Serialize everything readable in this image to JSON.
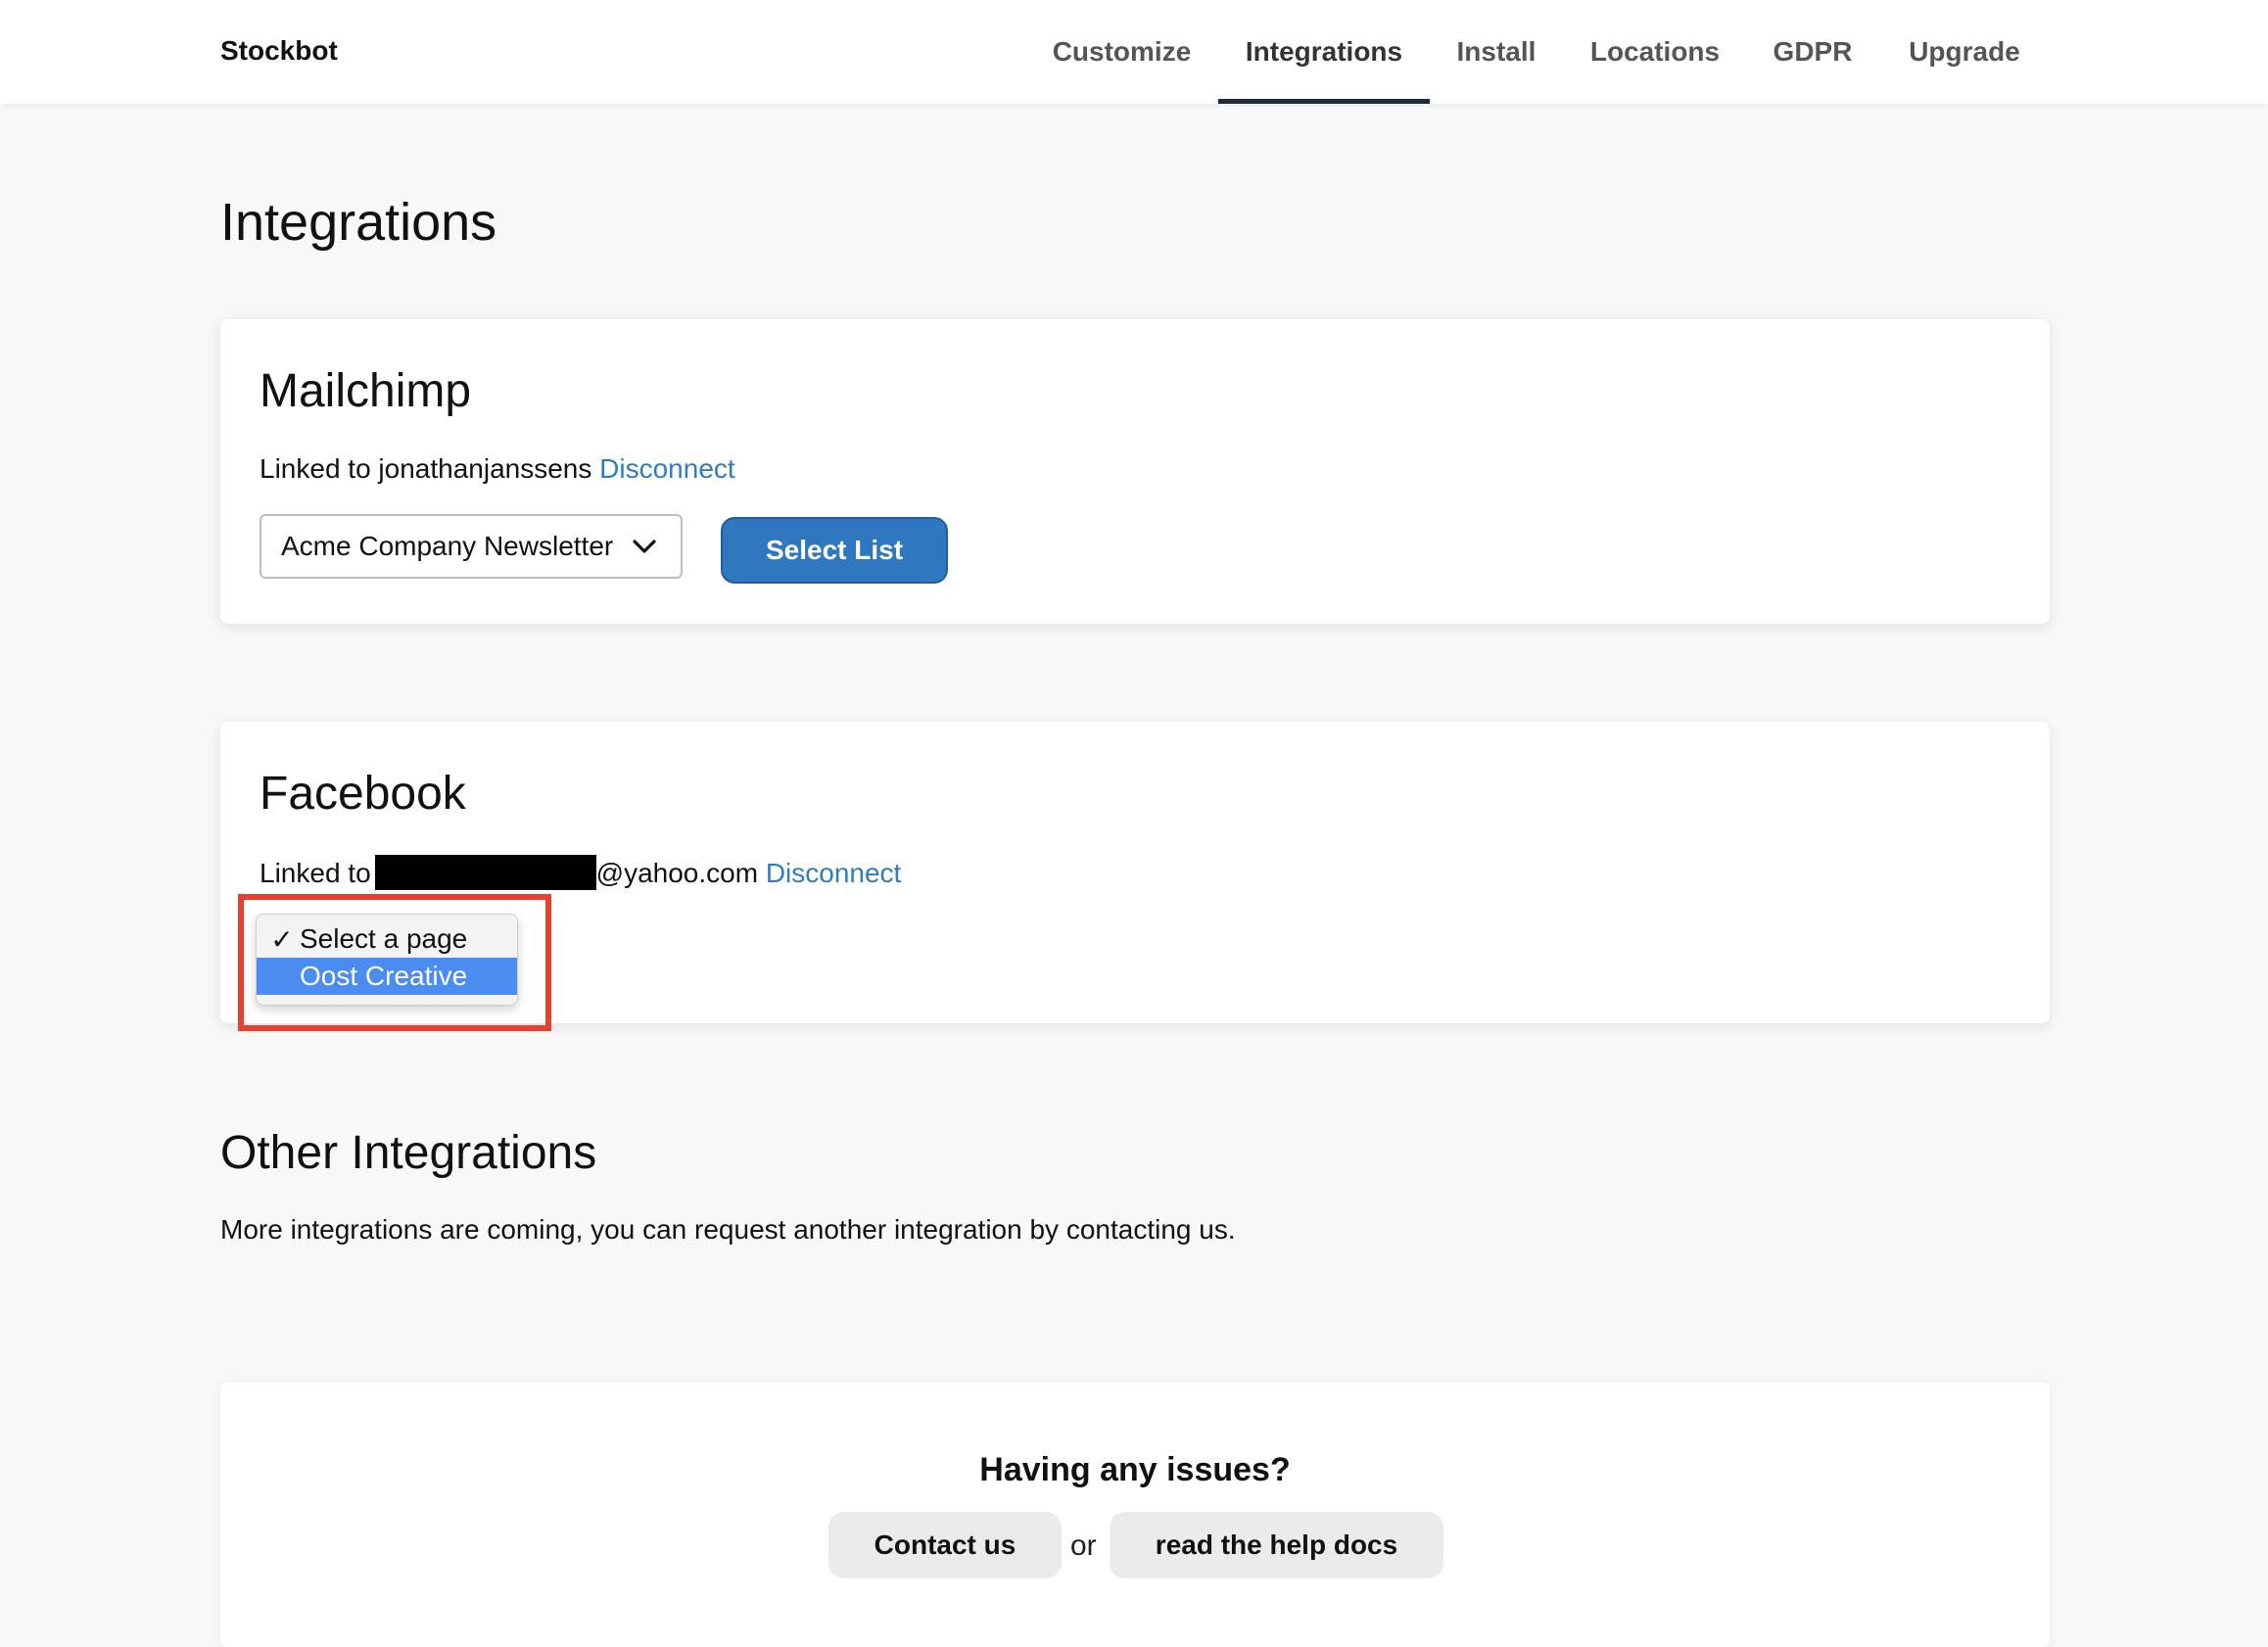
{
  "app": {
    "brand": "Stockbot"
  },
  "nav": {
    "items": [
      {
        "label": "Customize"
      },
      {
        "label": "Integrations",
        "active": true
      },
      {
        "label": "Install"
      },
      {
        "label": "Locations"
      },
      {
        "label": "GDPR"
      },
      {
        "label": "Upgrade"
      }
    ]
  },
  "page": {
    "title": "Integrations"
  },
  "mailchimp": {
    "title": "Mailchimp",
    "linked_prefix": "Linked to jonathanjanssens ",
    "disconnect": "Disconnect",
    "list_select_value": "Acme Company Newsletter",
    "select_button": "Select List"
  },
  "facebook": {
    "title": "Facebook",
    "linked_prefix": "Linked to",
    "email_suffix": "@yahoo.com ",
    "disconnect": "Disconnect",
    "page_options": [
      {
        "label": "Select a page",
        "checked": true,
        "check_mark": "✓"
      },
      {
        "label": "Oost Creative",
        "highlighted": true
      }
    ]
  },
  "other": {
    "title": "Other Integrations",
    "text": "More integrations are coming, you can request another integration by contacting us."
  },
  "help": {
    "title": "Having any issues?",
    "contact": "Contact us",
    "or": "or",
    "docs": "read the help docs"
  },
  "colors": {
    "link": "#2f7dc0",
    "primary_button": "#2f78bf",
    "highlight_box": "#e8402e",
    "option_highlight": "#4a8cf0",
    "active_tab_underline": "#1c2a3a"
  }
}
